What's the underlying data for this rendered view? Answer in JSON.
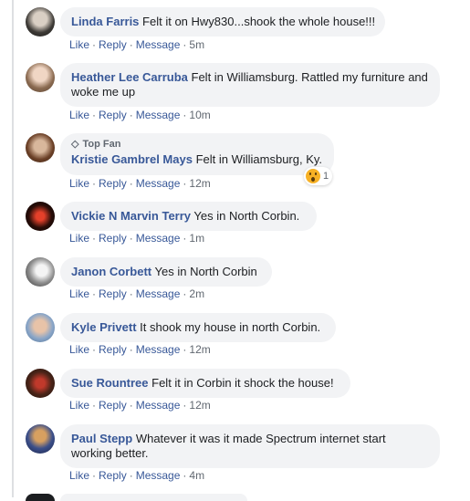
{
  "actions": {
    "like": "Like",
    "reply": "Reply",
    "message": "Message",
    "sep": "·"
  },
  "comments": [
    {
      "name": "Linda Farris",
      "text": "Felt it on Hwy830...shook the whole house!!!",
      "time": "5m"
    },
    {
      "name": "Heather Lee Carruba",
      "text": "Felt in Williamsburg. Rattled my furniture and woke me up",
      "time": "10m"
    },
    {
      "badge": "Top Fan",
      "name": "Kristie Gambrel Mays",
      "text": "Felt in Williamsburg, Ky.",
      "time": "12m",
      "reaction": {
        "icon": "wow-reaction-icon",
        "count": "1"
      }
    },
    {
      "name": "Vickie N Marvin Terry",
      "text": "Yes in North Corbin.",
      "time": "1m"
    },
    {
      "name": "Janon Corbett",
      "text": "Yes in North Corbin",
      "time": "2m"
    },
    {
      "name": "Kyle Privett",
      "text": "It shook my house in north Corbin.",
      "time": "12m"
    },
    {
      "name": "Sue Rountree",
      "text": "Felt it in Corbin it shock the house!",
      "time": "12m"
    },
    {
      "name": "Paul Stepp",
      "text": "Whatever it was it made Spectrum internet start working better.",
      "time": "4m"
    }
  ]
}
